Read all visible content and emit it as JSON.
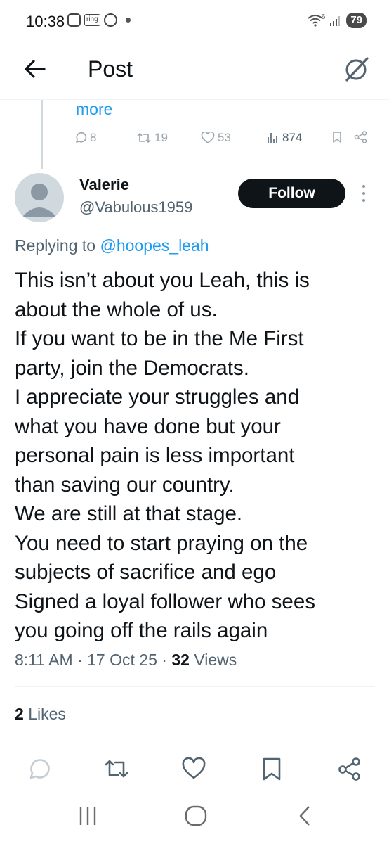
{
  "status_bar": {
    "time": "10:38",
    "ring_label": "ring",
    "battery": "79",
    "network": "6"
  },
  "header": {
    "title": "Post",
    "icons": {
      "back": "arrow-left-icon",
      "grok": "grok-icon"
    }
  },
  "previous_post": {
    "more_label": "more",
    "replies": "8",
    "reposts": "19",
    "likes": "53",
    "views": "874"
  },
  "tweet": {
    "author_name": "Valerie",
    "author_handle": "@Vabulous1959",
    "follow_label": "Follow",
    "replying_prefix": "Replying to",
    "replying_to": "@hoopes_leah",
    "lines": [
      "This isn’t about you Leah, this is",
      "about the whole of us.",
      "If you want to be in the Me First",
      "party, join the Democrats.",
      "I appreciate your struggles and",
      "what you have done but your",
      "personal pain is less important",
      "than saving our country.",
      "We are still at that stage.",
      "You need to start praying on the",
      "subjects of sacrifice and ego",
      "Signed a loyal follower who sees",
      "you going off the rails again"
    ],
    "time": "8:11 AM",
    "date": "17 Oct 25",
    "views_count": "32",
    "views_label": "Views",
    "likes_count": "2",
    "likes_label": "Likes"
  },
  "colors": {
    "accent": "#1d9bf0",
    "text": "#0f1419",
    "secondary": "#536471",
    "follow_bg": "#0f1419"
  }
}
